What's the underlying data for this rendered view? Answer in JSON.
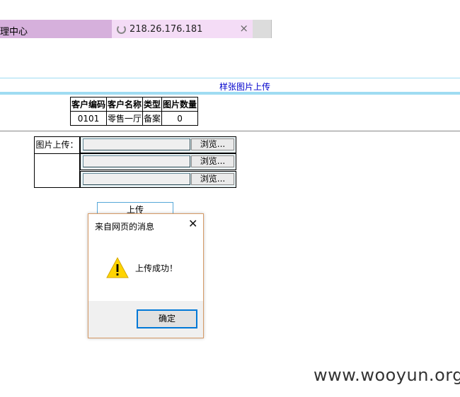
{
  "tabs": {
    "first_label": "理中心",
    "second_label": "218.26.176.181",
    "close_glyph": "×"
  },
  "page": {
    "title": "样张图片上传"
  },
  "info_table": {
    "headers": [
      "客户编码",
      "客户名称",
      "类型",
      "图片数量"
    ],
    "row": [
      "0101",
      "零售一厅",
      "备案",
      "0"
    ]
  },
  "upload": {
    "label": "图片上传：",
    "browse_label": "浏览...",
    "rows": 3,
    "submit_label": "上传"
  },
  "dialog": {
    "title": "来自网页的消息",
    "close_glyph": "✕",
    "message": "上传成功！",
    "ok_label": "确定",
    "icon": "warning-icon"
  },
  "watermark": "www.wooyun.org",
  "colors": {
    "tab_active": "#d6b0dc",
    "tab_loading": "#f4dcf6",
    "divider": "#9fdcf2",
    "title_link": "#0000cc",
    "dialog_border": "#d69a66",
    "ok_border": "#0078d7"
  }
}
